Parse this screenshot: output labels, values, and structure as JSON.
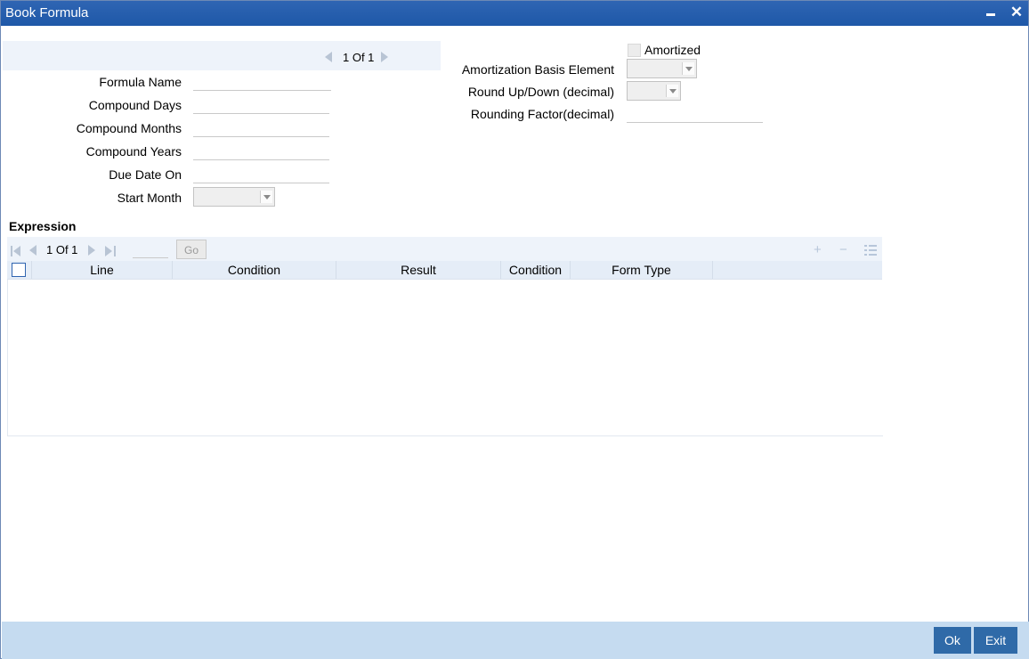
{
  "window": {
    "title": "Book Formula"
  },
  "record_nav": {
    "page": "1 Of 1"
  },
  "fields": {
    "formula_name": {
      "label": "Formula Name",
      "value": ""
    },
    "compound_days": {
      "label": "Compound Days",
      "value": ""
    },
    "compound_months": {
      "label": "Compound Months",
      "value": ""
    },
    "compound_years": {
      "label": "Compound Years",
      "value": ""
    },
    "due_date_on": {
      "label": "Due Date On",
      "value": ""
    },
    "start_month": {
      "label": "Start Month",
      "value": ""
    },
    "amortized": {
      "label": "Amortized",
      "checked": false
    },
    "amortization_basis_element": {
      "label": "Amortization Basis Element",
      "value": ""
    },
    "round_up_down": {
      "label": "Round Up/Down (decimal)",
      "value": ""
    },
    "rounding_factor": {
      "label": "Rounding Factor(decimal)",
      "value": ""
    }
  },
  "expression": {
    "heading": "Expression",
    "pager": {
      "page": "1 Of 1",
      "go_label": "Go"
    },
    "columns": [
      "Line",
      "Condition",
      "Result",
      "Condition",
      "Form Type"
    ],
    "rows": []
  },
  "footer": {
    "ok_label": "Ok",
    "exit_label": "Exit"
  }
}
